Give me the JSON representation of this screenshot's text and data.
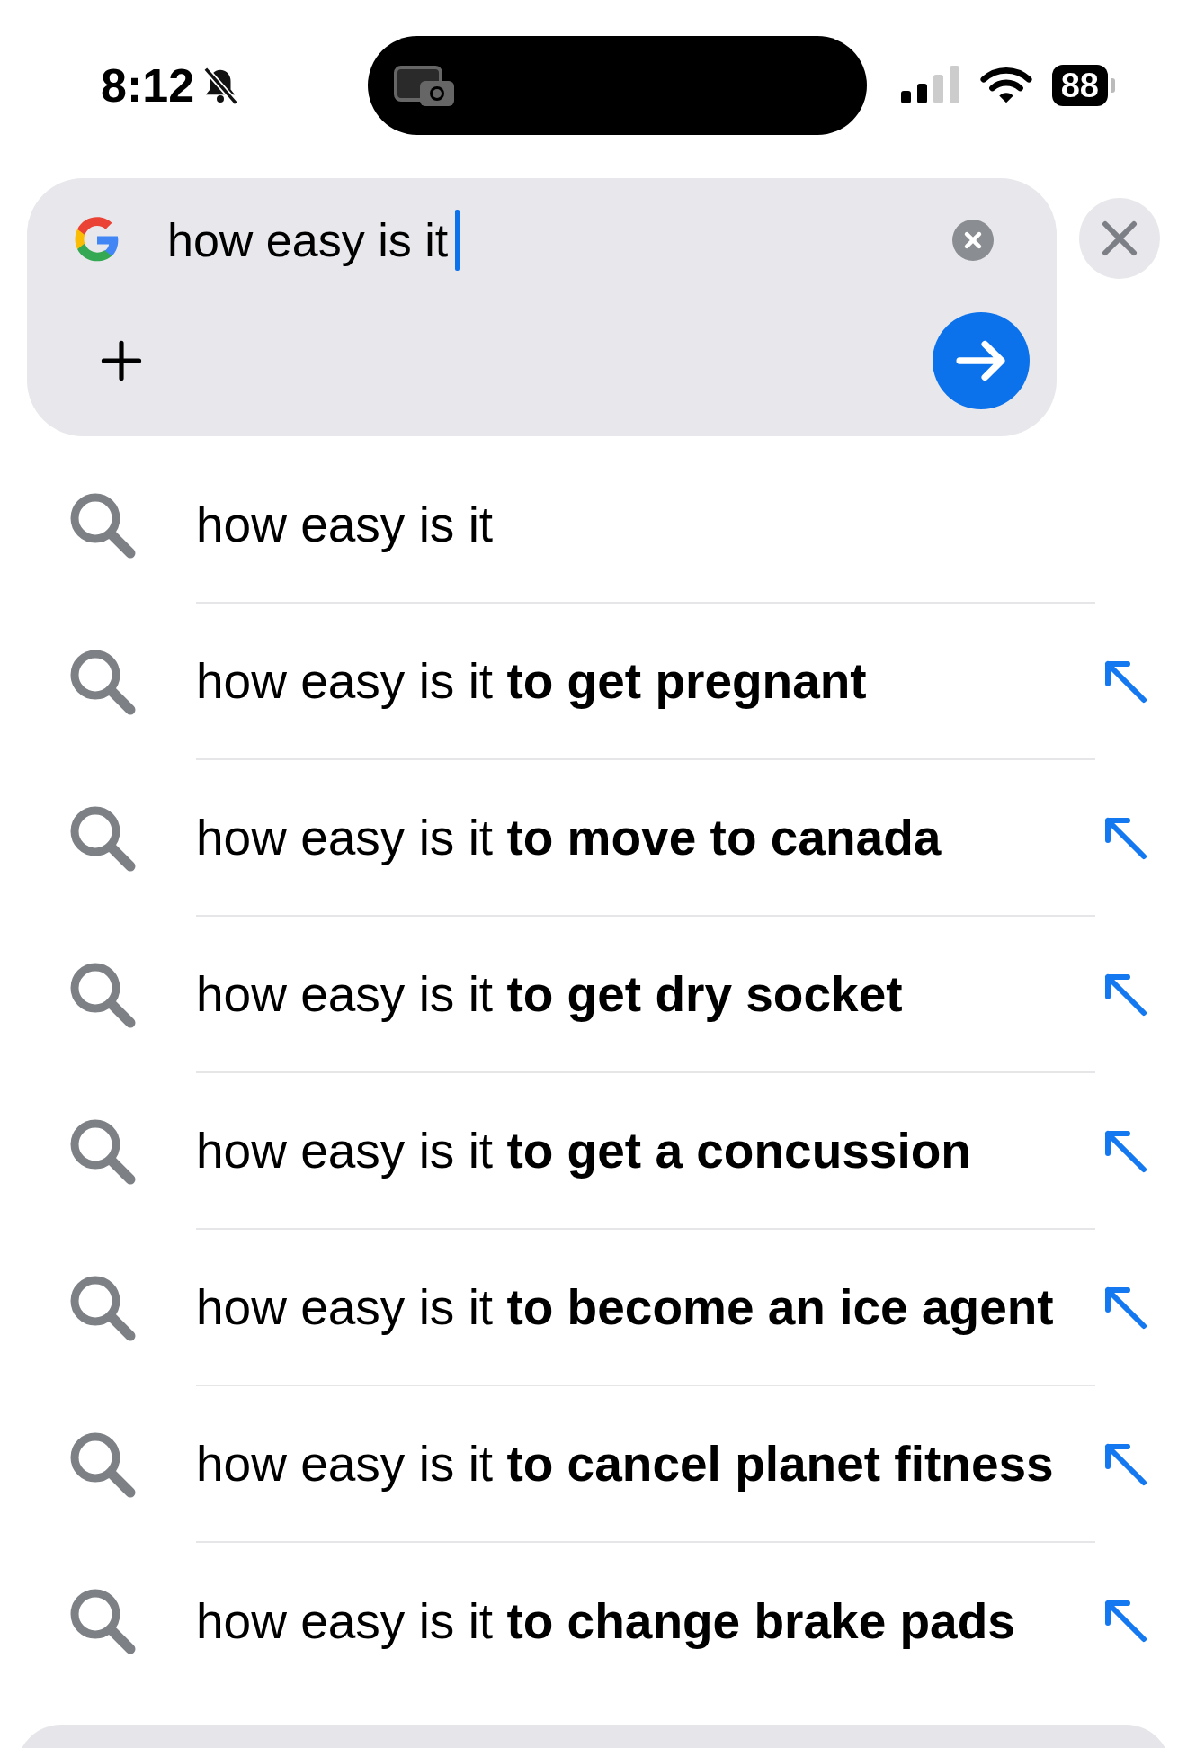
{
  "status_bar": {
    "time": "8:12",
    "battery": "88"
  },
  "search": {
    "value": "how easy is it"
  },
  "suggestions": [
    {
      "text": "how easy is it",
      "kind": "query"
    },
    {
      "text": "how easy is it **to get pregnant**",
      "kind": "completion"
    },
    {
      "text": "how easy is it **to move to canada**",
      "kind": "completion"
    },
    {
      "text": "how easy is it **to get dry socket**",
      "kind": "completion"
    },
    {
      "text": "how easy is it **to get a concussion**",
      "kind": "completion"
    },
    {
      "text": "how easy is it **to become an ice agent**",
      "kind": "completion"
    },
    {
      "text": "how easy is it **to cancel planet fitness**",
      "kind": "completion"
    },
    {
      "text": "how easy is it **to change brake pads**",
      "kind": "completion"
    }
  ]
}
